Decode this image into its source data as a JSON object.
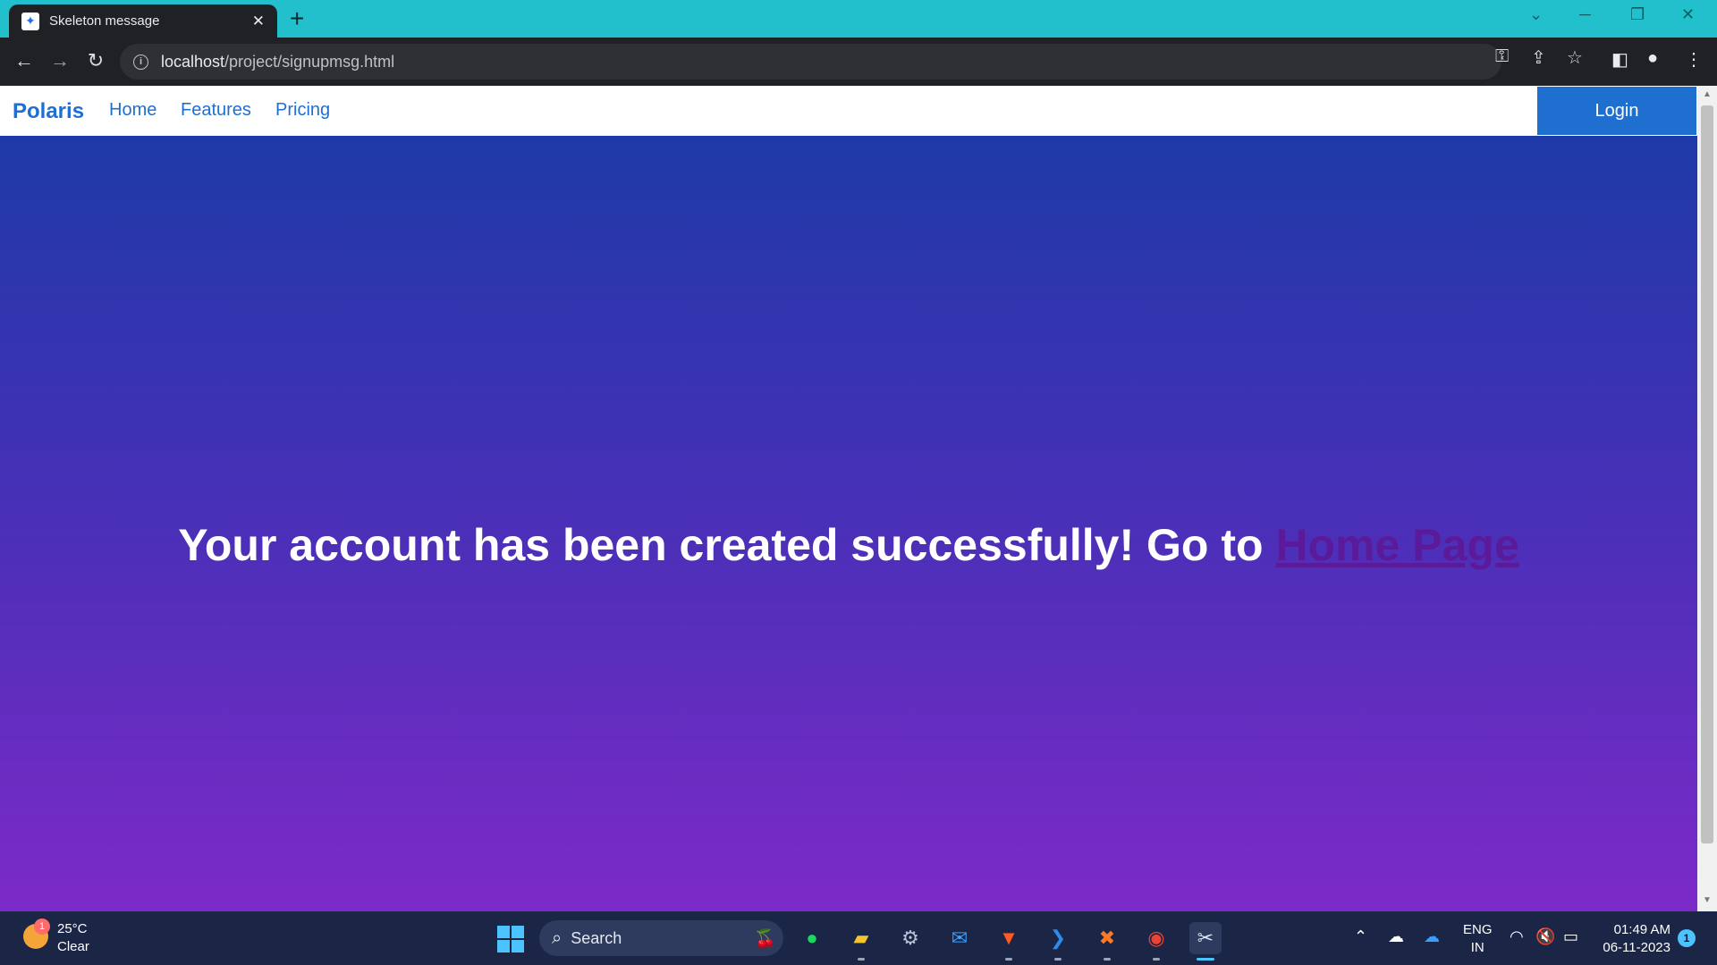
{
  "browser": {
    "tab_title": "Skeleton message",
    "url_host": "localhost",
    "url_path": "/project/signupmsg.html"
  },
  "navbar": {
    "brand": "Polaris",
    "links": [
      "Home",
      "Features",
      "Pricing"
    ],
    "login_label": "Login"
  },
  "hero": {
    "message": "Your account has been created successfully! Go to ",
    "link_text": "Home Page"
  },
  "taskbar": {
    "weather_temp": "25°C",
    "weather_status": "Clear",
    "weather_badge": "1",
    "search_label": "Search",
    "lang_line1": "ENG",
    "lang_line2": "IN",
    "time": "01:49 AM",
    "date": "06-11-2023",
    "notification_count": "1"
  },
  "colors": {
    "accent": "#1f6fd1",
    "gradient_top": "#1e3aa8",
    "gradient_bottom": "#7d2ac8",
    "titlebar": "#22bfcc"
  }
}
